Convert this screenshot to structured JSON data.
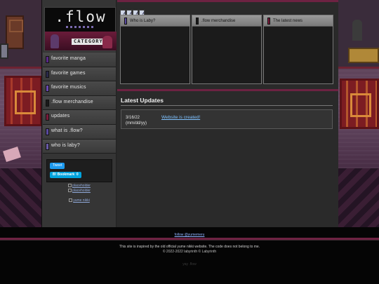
{
  "brand": {
    "logo": ".flow",
    "category_label": "CATEGORY"
  },
  "colors": {
    "accent": "#6d2242",
    "link": "#7ec1ff",
    "panel_header": "#8a8a8a"
  },
  "sidebar": {
    "items": [
      {
        "label": "favorite manga",
        "color": "#5a2a8a"
      },
      {
        "label": "favorite games",
        "color": "#2a2a4a"
      },
      {
        "label": "favorite musics",
        "color": "#6a4ab0"
      },
      {
        "label": ".flow merchandise",
        "color": "#1a1a1a"
      },
      {
        "label": "updates",
        "color": "#7a1a3a"
      },
      {
        "label": "what is .flow?",
        "color": "#5a4aa0"
      },
      {
        "label": "who is laby?",
        "color": "#6a5aa8"
      }
    ],
    "share": {
      "tweet": "Tweet",
      "bookmark": "B! Bookmark",
      "bookmark_count": "0"
    },
    "links": [
      "placeholder",
      "placeholder",
      "yume nikki"
    ]
  },
  "content": {
    "toolbar_icons": [
      "sound-icon",
      "sound-icon",
      "sound-icon",
      "sound-icon"
    ],
    "panels": [
      {
        "title": "Who is Laby?",
        "mark_color": "#5a4aa0"
      },
      {
        "title": ".flow merchandise",
        "mark_color": "#1a1a1a"
      },
      {
        "title": "The latest news",
        "mark_color": "#7a1a3a"
      }
    ],
    "updates": {
      "heading": "Latest Updates",
      "entries": [
        {
          "date": "3/16/22 (mm/dd/yy)",
          "text": "Website is created!"
        }
      ]
    }
  },
  "footer": {
    "link": "follow @yumemeru",
    "disclaimer": "This site is inspired by the old official yume nikki website. The code does not belong to me.",
    "copyright": "© 2022-2022 labyrinth © Labyrinth",
    "faint": "yay .flow"
  }
}
